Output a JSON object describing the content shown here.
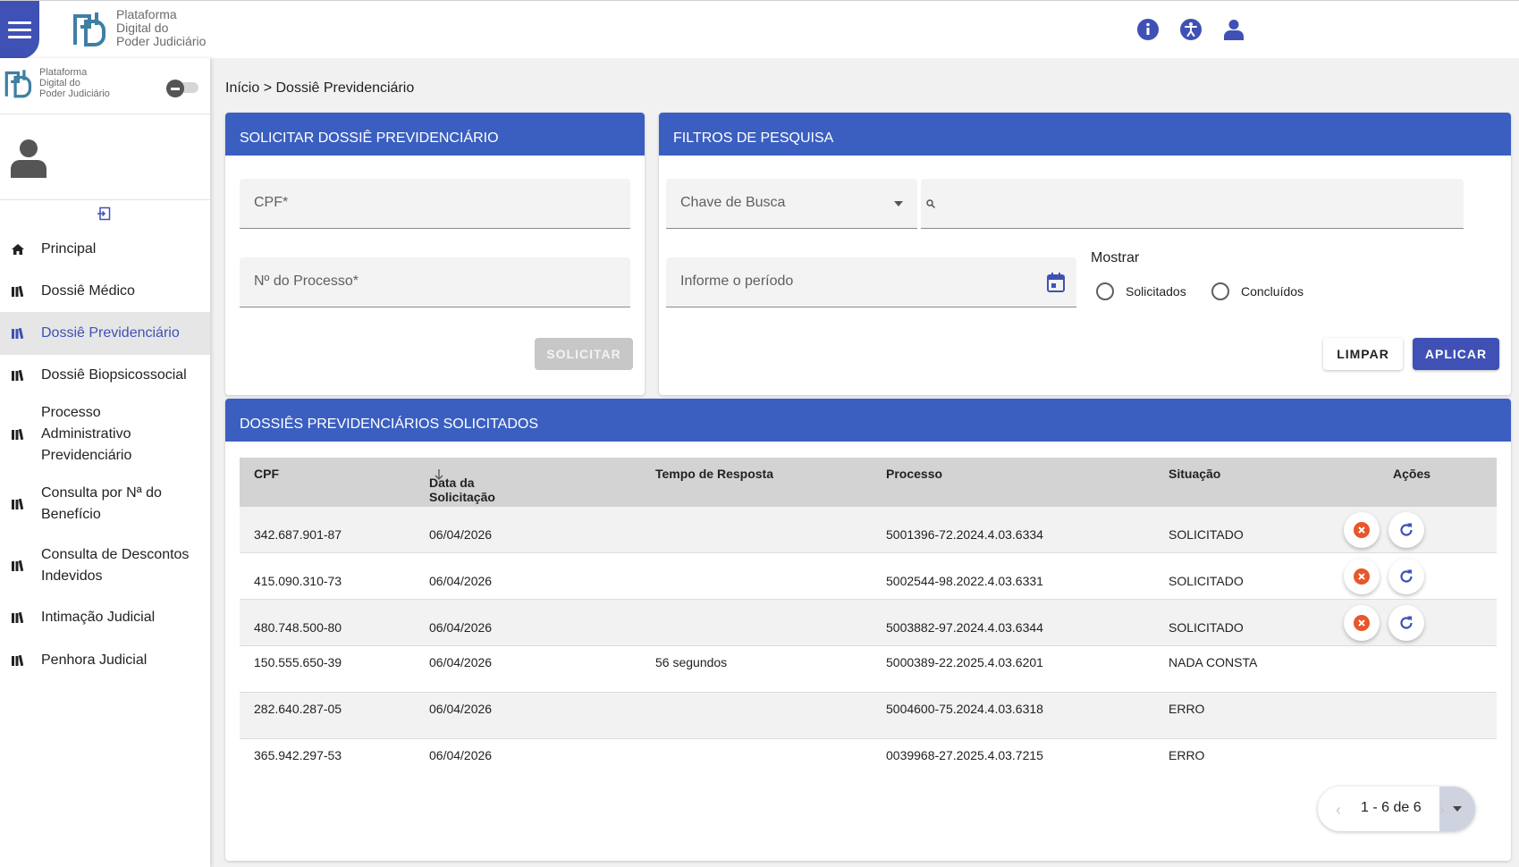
{
  "brand": {
    "line1": "Plataforma",
    "line2": "Digital do",
    "line3": "Poder Judiciário"
  },
  "sidebar": {
    "items": [
      {
        "label": "Principal",
        "icon": "home-icon"
      },
      {
        "label": "Dossiê Médico",
        "icon": "library-icon"
      },
      {
        "label": "Dossiê Previdenciário",
        "icon": "library-icon",
        "active": true
      },
      {
        "label": "Dossiê Biopsicossocial",
        "icon": "library-icon"
      },
      {
        "label": "Processo Administrativo Previdenciário",
        "line1": "Processo",
        "line2": "Administrativo",
        "line3": "Previdenciário",
        "icon": "library-icon"
      },
      {
        "label": "Consulta por Nª do Benefício",
        "line1": "Consulta por Nª do",
        "line2": "Benefício",
        "icon": "library-icon"
      },
      {
        "label": "Consulta de Descontos Indevidos",
        "line1": "Consulta de Descontos",
        "line2": "Indevidos",
        "icon": "library-icon"
      },
      {
        "label": "Intimação Judicial",
        "icon": "library-icon"
      },
      {
        "label": "Penhora Judicial",
        "icon": "library-icon"
      }
    ]
  },
  "breadcrumb": {
    "home": "Início",
    "sep": ">",
    "current": "Dossiê Previdenciário"
  },
  "request_card": {
    "title": "SOLICITAR DOSSIÊ PREVIDENCIÁRIO",
    "cpf_placeholder": "CPF*",
    "process_placeholder": "Nº do Processo*",
    "submit_label": "SOLICITAR"
  },
  "filters_card": {
    "title": "FILTROS DE PESQUISA",
    "search_key_placeholder": "Chave de Busca",
    "period_placeholder": "Informe o período",
    "show_label": "Mostrar",
    "radio_requested": "Solicitados",
    "radio_completed": "Concluídos",
    "clear_label": "LIMPAR",
    "apply_label": "APLICAR"
  },
  "results_card": {
    "title": "DOSSIÊS PREVIDENCIÁRIOS SOLICITADOS",
    "columns": [
      "CPF",
      "Data da Solicitação",
      "Tempo de Resposta",
      "Processo",
      "Situação",
      "Ações"
    ],
    "rows": [
      {
        "cpf": "342.687.901-87",
        "date": "06/04/2026",
        "time": "",
        "process": "5001396-72.2024.4.03.6334",
        "status": "SOLICITADO",
        "actions": true
      },
      {
        "cpf": "415.090.310-73",
        "date": "06/04/2026",
        "time": "",
        "process": "5002544-98.2022.4.03.6331",
        "status": "SOLICITADO",
        "actions": true
      },
      {
        "cpf": "480.748.500-80",
        "date": "06/04/2026",
        "time": "",
        "process": "5003882-97.2024.4.03.6344",
        "status": "SOLICITADO",
        "actions": true
      },
      {
        "cpf": "150.555.650-39",
        "date": "06/04/2026",
        "time": "56 segundos",
        "process": "5000389-22.2025.4.03.6201",
        "status": "NADA CONSTA",
        "actions": false
      },
      {
        "cpf": "282.640.287-05",
        "date": "06/04/2026",
        "time": "",
        "process": "5004600-75.2024.4.03.6318",
        "status": "ERRO",
        "actions": false
      },
      {
        "cpf": "365.942.297-53",
        "date": "06/04/2026",
        "time": "",
        "process": "0039968-27.2025.4.03.7215",
        "status": "ERRO",
        "actions": false
      }
    ],
    "pagination": "1 - 6 de 6"
  },
  "colors": {
    "primary": "#3f51b5",
    "header": "#3b5fc0",
    "cancel": "#e8562a",
    "refresh": "#3f51b5"
  }
}
